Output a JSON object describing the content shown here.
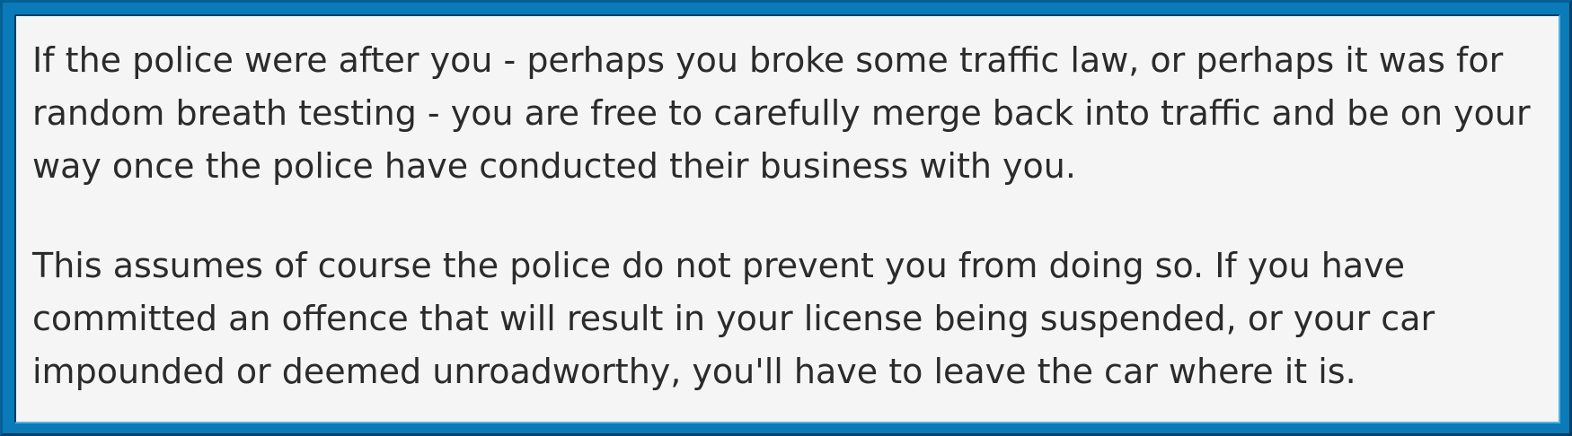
{
  "colors": {
    "frame": "#0a7ab8",
    "panel_background": "#f5f5f5",
    "text": "#2b2b2b"
  },
  "paragraphs": [
    {
      "lines": [
        "If the police were after you - perhaps you broke some traffic law, or perhaps it was for",
        "random breath testing - you are free to carefully merge back into traffic and be on your",
        "way once the police have conducted their business with you."
      ]
    },
    {
      "lines": [
        "This assumes of course the police do not prevent you from doing so. If you have",
        "committed an offence that will result in your license being suspended, or your car",
        "impounded or deemed unroadworthy, you'll have to leave the car where it is."
      ]
    }
  ]
}
